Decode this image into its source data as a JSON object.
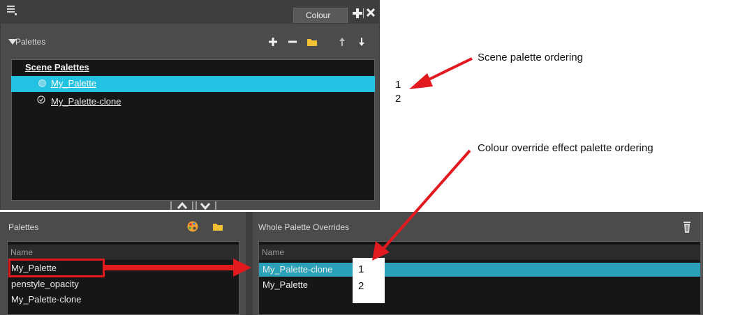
{
  "colour_panel": {
    "tab_label": "Colour",
    "section_title": "Palettes",
    "scene_heading": "Scene Palettes",
    "scene_palettes": [
      "My_Palette",
      "My_Palette-clone"
    ]
  },
  "palettes_panel": {
    "title": "Palettes",
    "column_header": "Name",
    "items": [
      "My_Palette",
      "penstyle_opacity",
      "My_Palette-clone"
    ]
  },
  "overrides_panel": {
    "title": "Whole Palette Overrides",
    "column_header": "Name",
    "items": [
      "My_Palette-clone",
      "My_Palette"
    ]
  },
  "annotations": {
    "scene_ordering": "Scene palette ordering",
    "override_ordering": "Colour override effect palette ordering",
    "scene_numbers": [
      "1",
      "2"
    ],
    "override_numbers": [
      "1",
      "2"
    ]
  },
  "colors": {
    "selection_cyan": "#23c2e2",
    "selection_teal": "#2aa1b8",
    "annotation_red": "#e2191f",
    "panel_gray": "#4b4b4b",
    "list_black": "#161616"
  }
}
